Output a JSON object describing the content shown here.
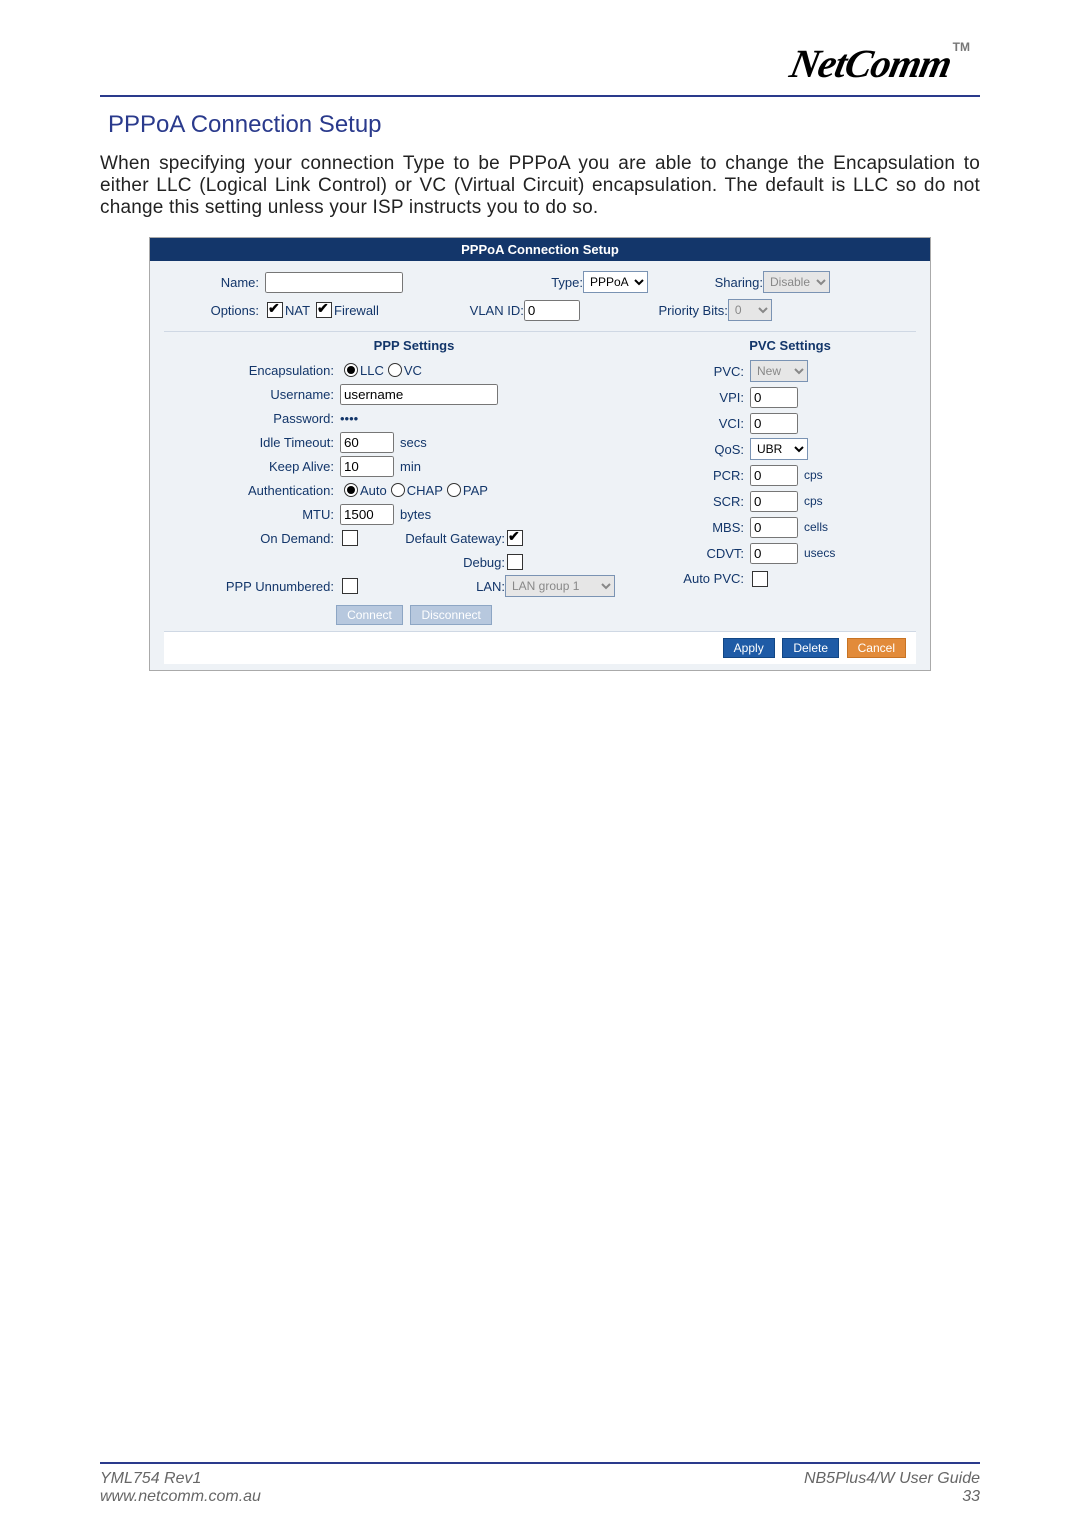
{
  "brand": {
    "logo": "NetComm",
    "tm": "TM"
  },
  "section_title": "PPPoA Connection Setup",
  "intro": "When specifying your connection Type to be PPPoA you are able to change the Encapsulation to either LLC (Logical Link Control) or VC (Virtual Circuit) encapsulation. The default is LLC so do not change this setting unless your ISP instructs you to do so.",
  "panel": {
    "header": "PPPoA Connection Setup",
    "top": {
      "name_label": "Name:",
      "name_value": "",
      "type_label": "Type:",
      "type_value": "PPPoA",
      "sharing_label": "Sharing:",
      "sharing_value": "Disable",
      "options_label": "Options:",
      "nat_label": "NAT",
      "firewall_label": "Firewall",
      "vlan_label": "VLAN ID:",
      "vlan_value": "0",
      "priority_label": "Priority Bits:",
      "priority_value": "0"
    },
    "ppp": {
      "title": "PPP Settings",
      "encap_label": "Encapsulation:",
      "encap_opts": {
        "llc": "LLC",
        "vc": "VC"
      },
      "user_label": "Username:",
      "user_value": "username",
      "pass_label": "Password:",
      "pass_value": "••••",
      "idle_label": "Idle Timeout:",
      "idle_value": "60",
      "idle_unit": "secs",
      "keep_label": "Keep Alive:",
      "keep_value": "10",
      "keep_unit": "min",
      "auth_label": "Authentication:",
      "auth_opts": {
        "auto": "Auto",
        "chap": "CHAP",
        "pap": "PAP"
      },
      "mtu_label": "MTU:",
      "mtu_value": "1500",
      "mtu_unit": "bytes",
      "ondem_label": "On Demand:",
      "defgw_label": "Default Gateway:",
      "debug_label": "Debug:",
      "unnum_label": "PPP Unnumbered:",
      "lan_label": "LAN:",
      "lan_value": "LAN group 1",
      "connect": "Connect",
      "disconnect": "Disconnect"
    },
    "pvc": {
      "title": "PVC Settings",
      "pvc_label": "PVC:",
      "pvc_value": "New",
      "vpi_label": "VPI:",
      "vpi_value": "0",
      "vci_label": "VCI:",
      "vci_value": "0",
      "qos_label": "QoS:",
      "qos_value": "UBR",
      "pcr_label": "PCR:",
      "pcr_value": "0",
      "pcr_unit": "cps",
      "scr_label": "SCR:",
      "scr_value": "0",
      "scr_unit": "cps",
      "mbs_label": "MBS:",
      "mbs_value": "0",
      "mbs_unit": "cells",
      "cdvt_label": "CDVT:",
      "cdvt_value": "0",
      "cdvt_unit": "usecs",
      "auto_label": "Auto PVC:"
    },
    "buttons": {
      "apply": "Apply",
      "delete": "Delete",
      "cancel": "Cancel"
    }
  },
  "footer": {
    "rev": "YML754 Rev1",
    "url": "www.netcomm.com.au",
    "guide": "NB5Plus4/W User Guide",
    "page": "33"
  }
}
